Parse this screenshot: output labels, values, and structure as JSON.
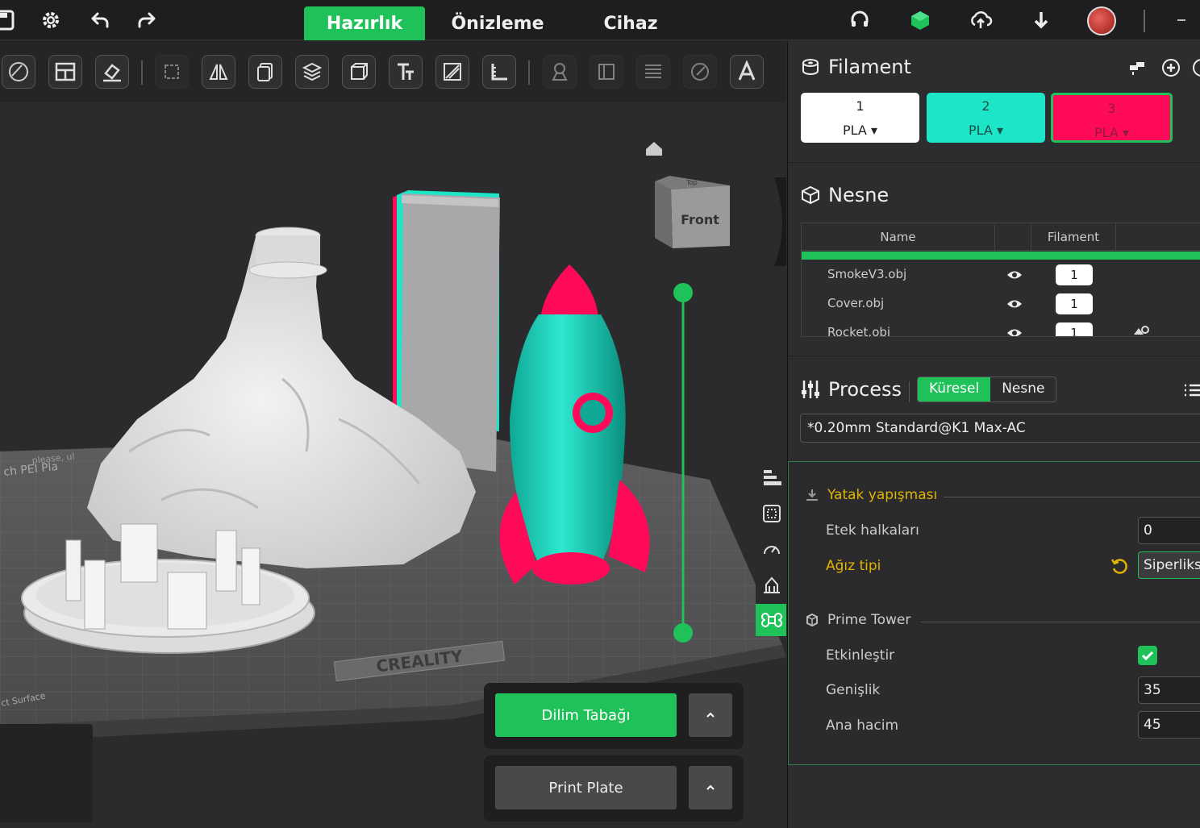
{
  "tabs": [
    {
      "label": "Hazırlık",
      "active": true
    },
    {
      "label": "Önizleme",
      "active": false
    },
    {
      "label": "Cihaz",
      "active": false
    }
  ],
  "filament": {
    "title": "Filament",
    "cards": [
      {
        "num": "1",
        "type": "PLA",
        "color": "#ffffff"
      },
      {
        "num": "2",
        "type": "PLA",
        "color": "#1de6c8"
      },
      {
        "num": "3",
        "type": "PLA",
        "color": "#ff0a59"
      }
    ]
  },
  "nesne": {
    "title": "Nesne",
    "col_name": "Name",
    "col_filament": "Filament",
    "rows": [
      {
        "name": "SmokeV3.obj",
        "filament": "1"
      },
      {
        "name": "Cover.obj",
        "filament": "1"
      },
      {
        "name": "Rocket.obj",
        "filament": "1"
      }
    ]
  },
  "process": {
    "title": "Process",
    "seg_global": "Küresel",
    "seg_object": "Nesne",
    "preset": "*0.20mm Standard@K1 Max-AC",
    "groups": {
      "bed_adhesion": "Yatak yapışması",
      "prime_tower": "Prime Tower"
    },
    "options": {
      "skirt_loops_label": "Etek halkaları",
      "skirt_loops_value": "0",
      "brim_type_label": "Ağız tipi",
      "brim_type_value": "Siperliksi",
      "enable_label": "Etkinleştir",
      "width_label": "Genişlik",
      "width_value": "35",
      "volume_label": "Ana hacim",
      "volume_value": "45"
    }
  },
  "viewport": {
    "view_cube_front": "Front",
    "view_cube_top": "Top",
    "bed_brand": "CREALITY",
    "plate_text": "ch PEI Pla",
    "plate_text2": "please, ul",
    "plate_text3": "ct Surface"
  },
  "buttons": {
    "slice": "Dilim Tabağı",
    "print": "Print Plate"
  },
  "colors": {
    "accent": "#1fc259",
    "yellow": "#e0b400",
    "teal": "#1de6c8",
    "pink": "#ff0a59"
  }
}
